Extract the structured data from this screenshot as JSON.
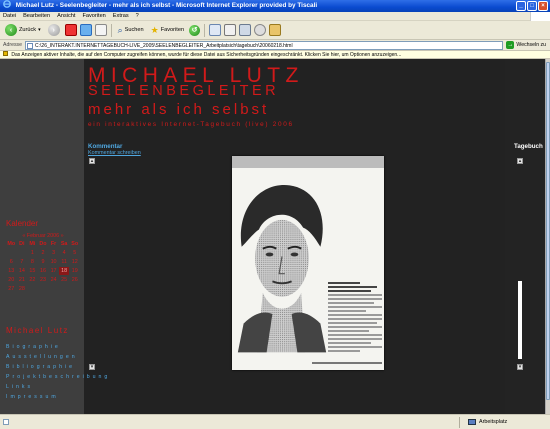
{
  "window": {
    "title": "Michael Lutz - Seelenbegleiter - mehr als ich selbst - Microsoft Internet Explorer provided by Tiscali"
  },
  "menu": [
    "Datei",
    "Bearbeiten",
    "Ansicht",
    "Favoriten",
    "Extras",
    "?"
  ],
  "toolbar": {
    "back_label": "Zurück",
    "search_label": "Suchen",
    "favorites_label": "Favoriten"
  },
  "address": {
    "label": "Adresse",
    "value": "C:\\26_INTERAKT.INTERNETTAGEBUCH-LIVE_2005\\SEELENBEGLEITER_Arbeitplatsich\\tagebuch\\20060218.html",
    "go_label": "Wechseln zu"
  },
  "infobar": {
    "text": "Das Anzeigen aktiver Inhalte, die auf den Computer zugreifen können, wurde für diese Datei aus Sicherheitsgründen eingeschränkt. Klicken Sie hier, um Optionen anzuzeigen..."
  },
  "header": {
    "name": "MICHAEL LUTZ",
    "role": "SEELENBEGLEITER",
    "tagline": "mehr als ich selbst",
    "subtitle": "ein interaktives Internet-Tagebuch (live) 2006"
  },
  "kommentar": {
    "title": "Kommentar",
    "link": "Kommentar schreiben"
  },
  "tagebuch": {
    "title": "Tagebuch"
  },
  "kalender": {
    "title": "Kalender",
    "month": "« Februar 2006 »",
    "days": [
      "Mo",
      "Di",
      "Mi",
      "Do",
      "Fr",
      "Sa",
      "So"
    ],
    "today": "18",
    "cells": [
      "",
      "",
      "1",
      "2",
      "3",
      "4",
      "5",
      "6",
      "7",
      "8",
      "9",
      "10",
      "11",
      "12",
      "13",
      "14",
      "15",
      "16",
      "17",
      "18",
      "19",
      "20",
      "21",
      "22",
      "23",
      "24",
      "25",
      "26",
      "27",
      "28",
      "",
      "",
      "",
      "",
      ""
    ]
  },
  "sidebar_nav": {
    "title": "Michael Lutz",
    "items": [
      "Biographie",
      "Ausstellungen",
      "Bibliographie",
      "Projektbeschreibung",
      "Links",
      "Impressum"
    ]
  },
  "status": {
    "zone": "Arbeitsplatz"
  }
}
